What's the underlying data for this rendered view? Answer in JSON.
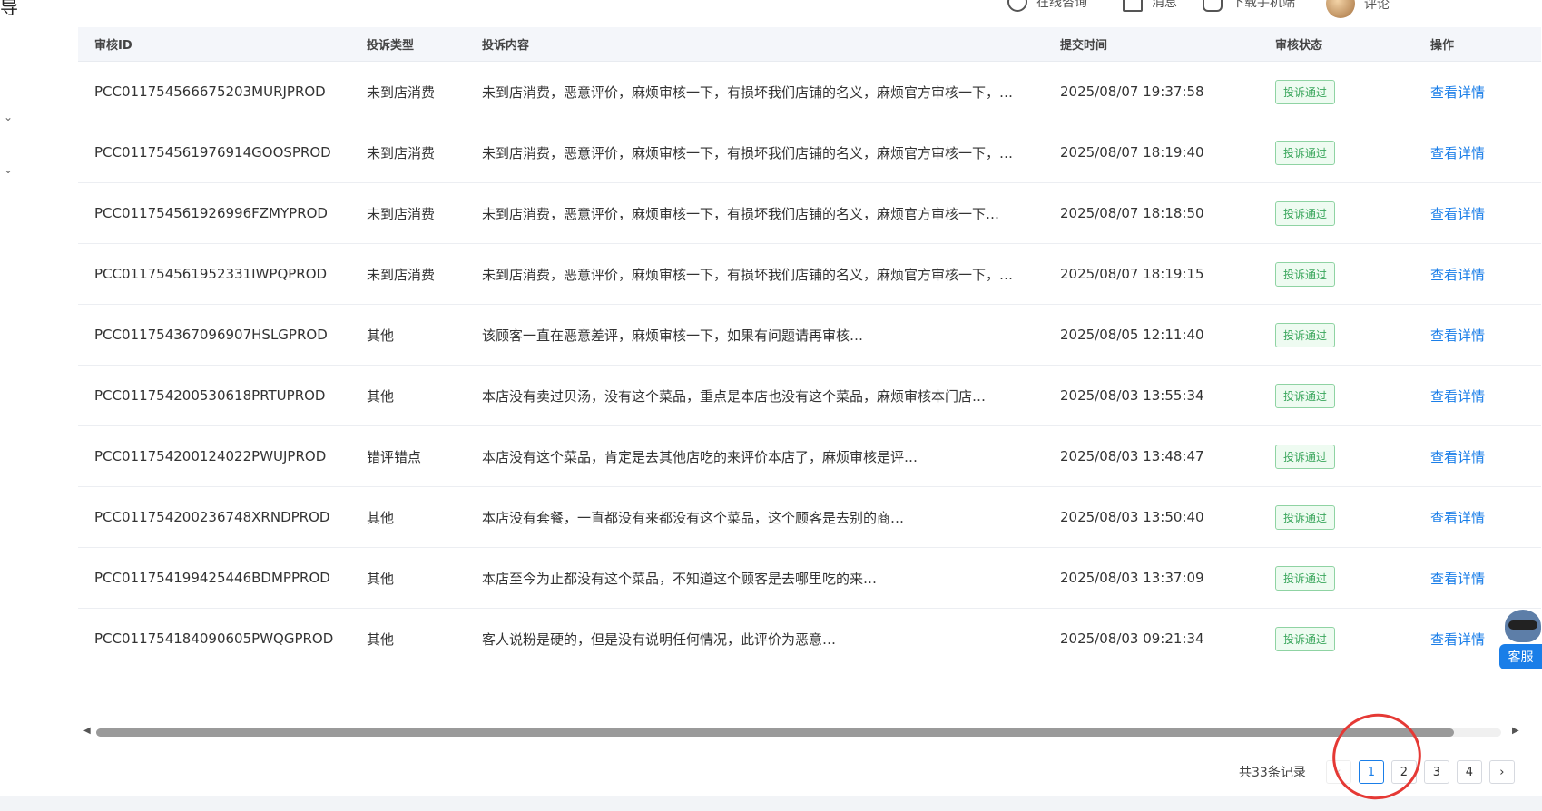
{
  "corner_char": "导",
  "topbar": {
    "consult": "在线咨询",
    "messages": "消息",
    "download": "下载手机端",
    "user": "评论"
  },
  "table": {
    "columns": [
      "审核ID",
      "投诉类型",
      "投诉内容",
      "提交时间",
      "审核状态",
      "操作"
    ],
    "rows": [
      {
        "id": "PCC011754566675203MURJPROD",
        "type": "未到店消费",
        "content": "未到店消费，恶意评价，麻烦审核一下，有损坏我们店铺的名义，麻烦官方审核一下，…",
        "time": "2025/08/07 19:37:58",
        "status": "投诉通过",
        "action": "查看详情"
      },
      {
        "id": "PCC011754561976914GOOSPROD",
        "type": "未到店消费",
        "content": "未到店消费，恶意评价，麻烦审核一下，有损坏我们店铺的名义，麻烦官方审核一下，…",
        "time": "2025/08/07 18:19:40",
        "status": "投诉通过",
        "action": "查看详情"
      },
      {
        "id": "PCC011754561926996FZMYPROD",
        "type": "未到店消费",
        "content": "未到店消费，恶意评价，麻烦审核一下，有损坏我们店铺的名义，麻烦官方审核一下…",
        "time": "2025/08/07 18:18:50",
        "status": "投诉通过",
        "action": "查看详情"
      },
      {
        "id": "PCC011754561952331IWPQPROD",
        "type": "未到店消费",
        "content": "未到店消费，恶意评价，麻烦审核一下，有损坏我们店铺的名义，麻烦官方审核一下，…",
        "time": "2025/08/07 18:19:15",
        "status": "投诉通过",
        "action": "查看详情"
      },
      {
        "id": "PCC011754367096907HSLGPROD",
        "type": "其他",
        "content": "该顾客一直在恶意差评，麻烦审核一下，如果有问题请再审核…",
        "time": "2025/08/05 12:11:40",
        "status": "投诉通过",
        "action": "查看详情"
      },
      {
        "id": "PCC011754200530618PRTUPROD",
        "type": "其他",
        "content": "本店没有卖过贝汤，没有这个菜品，重点是本店也没有这个菜品，麻烦审核本门店…",
        "time": "2025/08/03 13:55:34",
        "status": "投诉通过",
        "action": "查看详情"
      },
      {
        "id": "PCC011754200124022PWUJPROD",
        "type": "错评错点",
        "content": "本店没有这个菜品，肯定是去其他店吃的来评价本店了，麻烦审核是评…",
        "time": "2025/08/03 13:48:47",
        "status": "投诉通过",
        "action": "查看详情"
      },
      {
        "id": "PCC011754200236748XRNDPROD",
        "type": "其他",
        "content": "本店没有套餐，一直都没有来都没有这个菜品，这个顾客是去别的商…",
        "time": "2025/08/03 13:50:40",
        "status": "投诉通过",
        "action": "查看详情"
      },
      {
        "id": "PCC011754199425446BDMPPROD",
        "type": "其他",
        "content": "本店至今为止都没有这个菜品，不知道这个顾客是去哪里吃的来…",
        "time": "2025/08/03 13:37:09",
        "status": "投诉通过",
        "action": "查看详情"
      },
      {
        "id": "PCC011754184090605PWQGPROD",
        "type": "其他",
        "content": "客人说粉是硬的，但是没有说明任何情况，此评价为恶意…",
        "time": "2025/08/03 09:21:34",
        "status": "投诉通过",
        "action": "查看详情"
      }
    ]
  },
  "pagination": {
    "total": "共33条记录",
    "pages": [
      "1",
      "2",
      "3",
      "4"
    ],
    "active": "1",
    "prev": "‹",
    "next": "›"
  },
  "customer_service": {
    "label": "客服"
  },
  "colors": {
    "link": "#1a7ee8",
    "status_green": "#3aa65c",
    "annotation_red": "#e53935"
  }
}
